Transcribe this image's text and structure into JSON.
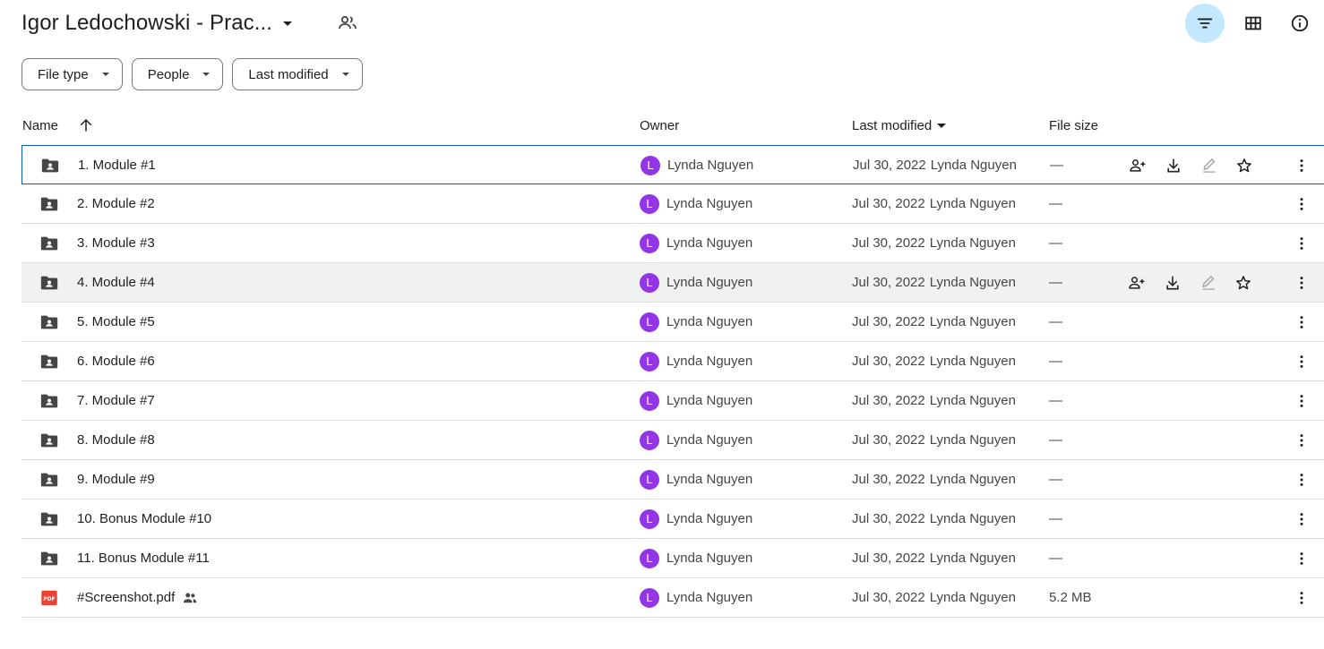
{
  "header": {
    "title": "Igor Ledochowski - Prac...",
    "icons": [
      "shared-folder-icon",
      "filter-icon",
      "grid-view-icon",
      "info-icon"
    ],
    "accent_color": "#c2e7ff"
  },
  "filters": [
    {
      "label": "File type"
    },
    {
      "label": "People"
    },
    {
      "label": "Last modified"
    }
  ],
  "columns": {
    "name": "Name",
    "owner": "Owner",
    "last_modified": "Last modified",
    "file_size": "File size"
  },
  "rows": [
    {
      "name": "1. Module #1",
      "type": "shared-folder",
      "owner_initial": "L",
      "owner": "Lynda Nguyen",
      "date": "Jul 30, 2022",
      "modified_by": "Lynda Nguyen",
      "size": "—",
      "state": "selected"
    },
    {
      "name": "2. Module #2",
      "type": "shared-folder",
      "owner_initial": "L",
      "owner": "Lynda Nguyen",
      "date": "Jul 30, 2022",
      "modified_by": "Lynda Nguyen",
      "size": "—",
      "state": ""
    },
    {
      "name": "3. Module #3",
      "type": "shared-folder",
      "owner_initial": "L",
      "owner": "Lynda Nguyen",
      "date": "Jul 30, 2022",
      "modified_by": "Lynda Nguyen",
      "size": "—",
      "state": ""
    },
    {
      "name": "4. Module #4",
      "type": "shared-folder",
      "owner_initial": "L",
      "owner": "Lynda Nguyen",
      "date": "Jul 30, 2022",
      "modified_by": "Lynda Nguyen",
      "size": "—",
      "state": "hover"
    },
    {
      "name": "5. Module #5",
      "type": "shared-folder",
      "owner_initial": "L",
      "owner": "Lynda Nguyen",
      "date": "Jul 30, 2022",
      "modified_by": "Lynda Nguyen",
      "size": "—",
      "state": ""
    },
    {
      "name": "6. Module #6",
      "type": "shared-folder",
      "owner_initial": "L",
      "owner": "Lynda Nguyen",
      "date": "Jul 30, 2022",
      "modified_by": "Lynda Nguyen",
      "size": "—",
      "state": ""
    },
    {
      "name": "7. Module #7",
      "type": "shared-folder",
      "owner_initial": "L",
      "owner": "Lynda Nguyen",
      "date": "Jul 30, 2022",
      "modified_by": "Lynda Nguyen",
      "size": "—",
      "state": ""
    },
    {
      "name": "8. Module #8",
      "type": "shared-folder",
      "owner_initial": "L",
      "owner": "Lynda Nguyen",
      "date": "Jul 30, 2022",
      "modified_by": "Lynda Nguyen",
      "size": "—",
      "state": ""
    },
    {
      "name": "9. Module #9",
      "type": "shared-folder",
      "owner_initial": "L",
      "owner": "Lynda Nguyen",
      "date": "Jul 30, 2022",
      "modified_by": "Lynda Nguyen",
      "size": "—",
      "state": ""
    },
    {
      "name": "10. Bonus Module #10",
      "type": "shared-folder",
      "owner_initial": "L",
      "owner": "Lynda Nguyen",
      "date": "Jul 30, 2022",
      "modified_by": "Lynda Nguyen",
      "size": "—",
      "state": ""
    },
    {
      "name": "11. Bonus Module #11",
      "type": "shared-folder",
      "owner_initial": "L",
      "owner": "Lynda Nguyen",
      "date": "Jul 30, 2022",
      "modified_by": "Lynda Nguyen",
      "size": "—",
      "state": ""
    },
    {
      "name": "#Screenshot.pdf",
      "type": "pdf",
      "shared": true,
      "owner_initial": "L",
      "owner": "Lynda Nguyen",
      "date": "Jul 30, 2022",
      "modified_by": "Lynda Nguyen",
      "size": "5.2 MB",
      "state": ""
    }
  ],
  "row_action_icons": [
    "share-icon",
    "download-icon",
    "rename-icon",
    "star-icon"
  ],
  "colors": {
    "avatar": "#9334e6",
    "selection_border": "#0b57d0",
    "hover_row": "#f0f2f1",
    "pdf_icon": "#ea4335",
    "folder_icon": "#444746"
  }
}
